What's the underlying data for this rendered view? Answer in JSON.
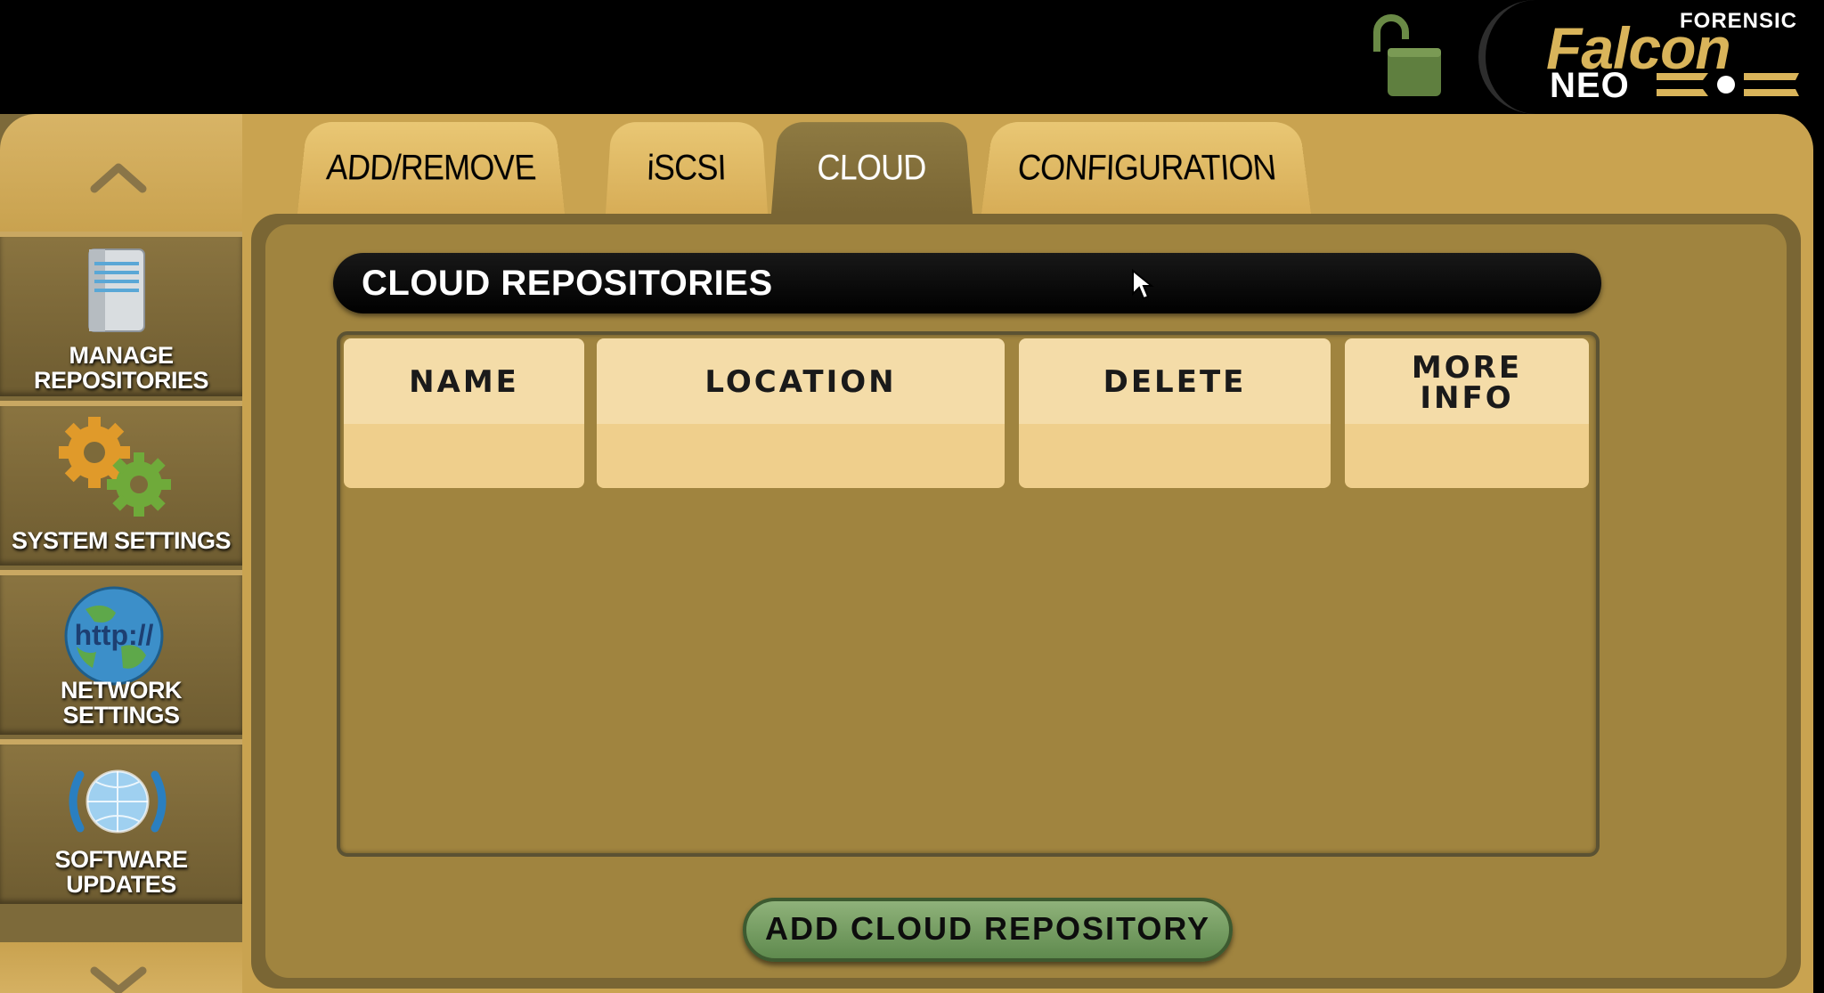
{
  "brand": {
    "forensic": "FORENSIC",
    "falcon": "Falcon",
    "neo": "NEO",
    "registered": "®"
  },
  "sidebar": {
    "items": [
      {
        "label_line1": "MANAGE",
        "label_line2": "REPOSITORIES",
        "icon": "server-icon"
      },
      {
        "label_line1": "SYSTEM SETTINGS",
        "icon": "gears-icon"
      },
      {
        "label_line1": "NETWORK",
        "label_line2": "SETTINGS",
        "icon": "globe-http-icon",
        "icon_text": "http://"
      },
      {
        "label_line1": "SOFTWARE",
        "label_line2": "UPDATES",
        "icon": "globe-refresh-icon"
      }
    ]
  },
  "tabs": [
    {
      "label": "ADD/REMOVE",
      "active": false
    },
    {
      "label": "iSCSI",
      "active": false
    },
    {
      "label": "CLOUD",
      "active": true
    },
    {
      "label": "CONFIGURATION",
      "active": false
    }
  ],
  "section_title": "CLOUD REPOSITORIES",
  "table": {
    "columns": [
      {
        "line1": "NAME"
      },
      {
        "line1": "LOCATION"
      },
      {
        "line1": "DELETE"
      },
      {
        "line1": "MORE",
        "line2": "INFO"
      }
    ],
    "rows": []
  },
  "add_button_label": "ADD CLOUD REPOSITORY",
  "colors": {
    "gold": "#c9a350",
    "panel": "#a0843f",
    "header_cell": "#f4dca8",
    "button_green": "#6f9a5c",
    "lock_green": "#5f7f3f"
  }
}
